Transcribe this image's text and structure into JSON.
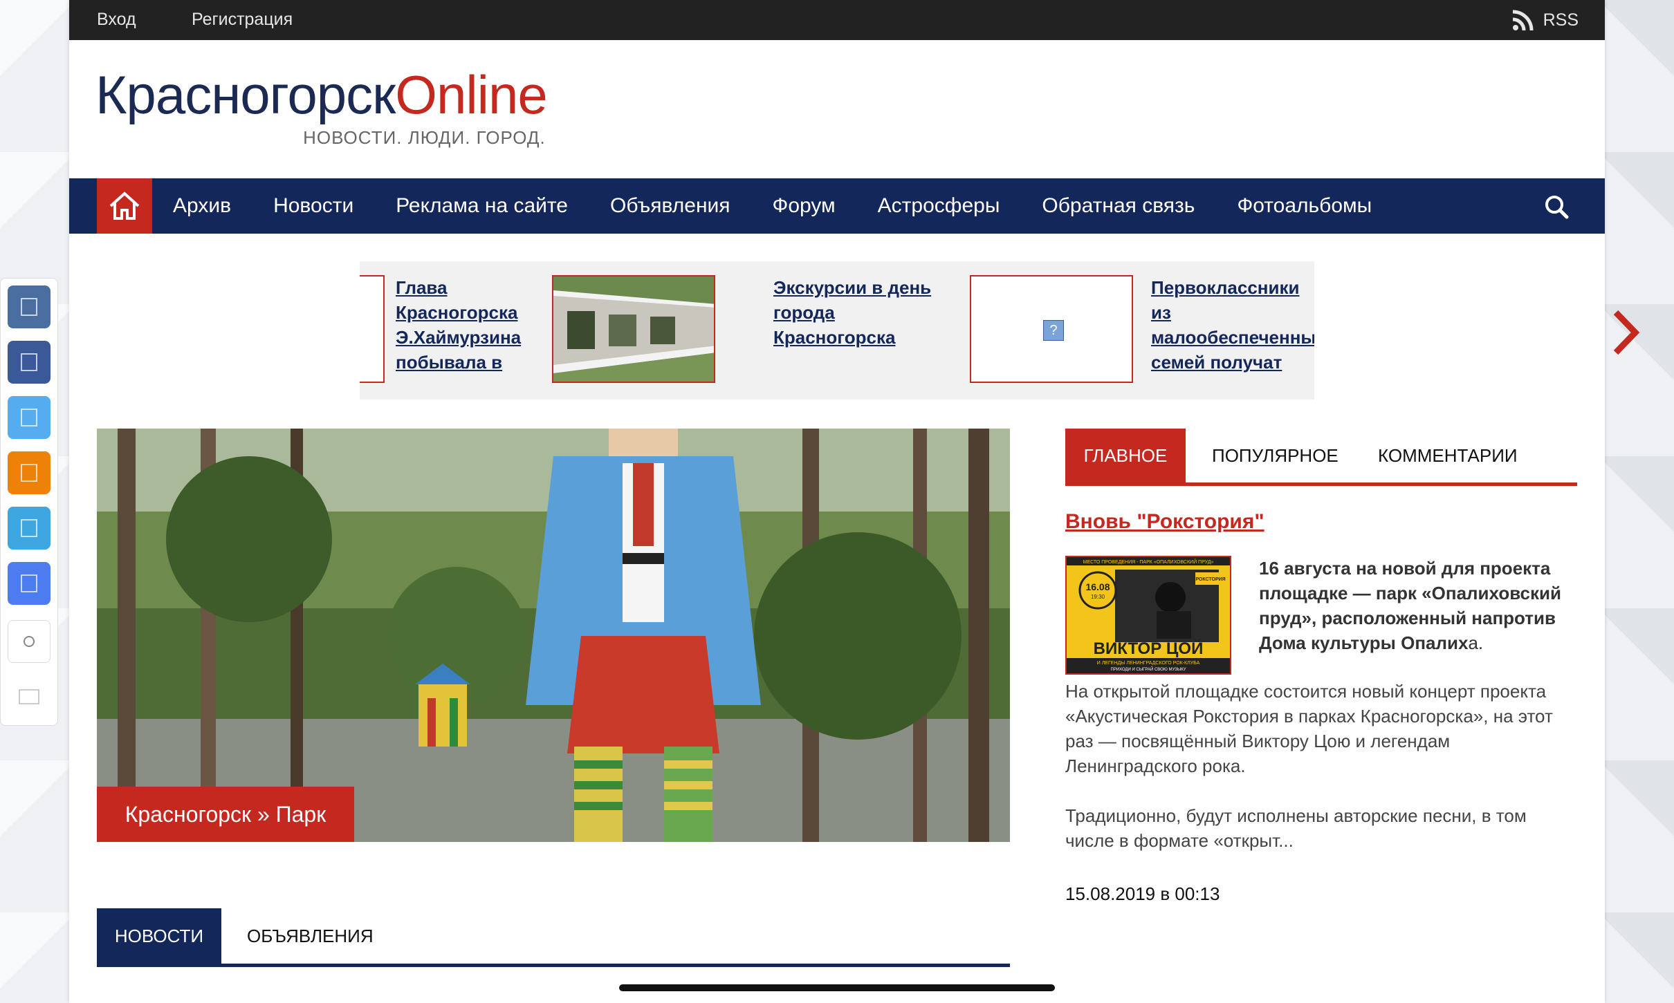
{
  "topbar": {
    "login": "Вход",
    "register": "Регистрация",
    "rss": "RSS"
  },
  "logo": {
    "part1": "Красногорск",
    "part2": "Online",
    "tagline": "НОВОСТИ. ЛЮДИ. ГОРОД."
  },
  "nav": {
    "home_icon": "home-icon",
    "items": [
      "Архив",
      "Новости",
      "Реклама на сайте",
      "Объявления",
      "Форум",
      "Астросферы",
      "Обратная связь",
      "Фотоальбомы"
    ],
    "search_icon": "search-icon"
  },
  "ticker": {
    "items": [
      {
        "text_lines": [
          "Глава",
          "Красногорска",
          "Э.Хаймурзина",
          "побывала в"
        ]
      },
      {
        "text_lines": [
          "Экскурсии в день",
          "города",
          "Красногорска"
        ]
      },
      {
        "text_lines": [
          "Первоклассники",
          "из",
          "малообеспеченных",
          "семей получат"
        ],
        "broken_image": "?"
      }
    ]
  },
  "share_buttons": [
    {
      "icon": "vk-icon",
      "color": "#4a6e9f"
    },
    {
      "icon": "facebook-icon",
      "color": "#3b5998"
    },
    {
      "icon": "twitter-icon",
      "color": "#55acee"
    },
    {
      "icon": "odnoklassniki-icon",
      "color": "#ee8208"
    },
    {
      "icon": "mailru-icon",
      "color": "#3ea6e0"
    },
    {
      "icon": "livejournal-icon",
      "color": "#4d7cf0"
    }
  ],
  "hero": {
    "caption": "Красногорск » Парк"
  },
  "right_tabs": [
    "ГЛАВНОЕ",
    "ПОПУЛЯРНОЕ",
    "КОММЕНТАРИИ"
  ],
  "article": {
    "title": "Вновь \"Рокстория\"",
    "poster": {
      "top": "МЕСТО ПРОВЕДЕНИЯ - ПАРК «ОПАЛИХОВСКИЙ ПРУД»",
      "date": "16.08",
      "time": "19:30",
      "name": "ВИКТОР ЦОЙ",
      "sub": "И ЛЕГЕНДЫ ЛЕНИНГРАДСКОГО РОК-КЛУБА",
      "sub2": "ПРИХОДИ И СЫГРАЙ СВОЮ МУЗЫКУ",
      "badge": "РОКСТОРИЯ"
    },
    "lead_bold": "16 августа на новой для проекта площадке — парк «Опалиховский пруд», расположенный напротив Дома культуры Опалих",
    "lead_normal": "а.",
    "para1": "На открытой площадке состоится новый концерт проекта «Акустическая Рокстория в парках Красногорска», на этот раз — посвящённый Виктору Цою и легендам Ленинградского рока.",
    "para2": "Традиционно, будут исполнены авторские песни, в том числе в формате «открыт...",
    "date": "15.08.2019 в 00:13"
  },
  "bottom_tabs": [
    "НОВОСТИ",
    "ОБЪЯВЛЕНИЯ"
  ],
  "colors": {
    "navy": "#14275a",
    "red": "#c4281f",
    "topbar": "#222222"
  }
}
